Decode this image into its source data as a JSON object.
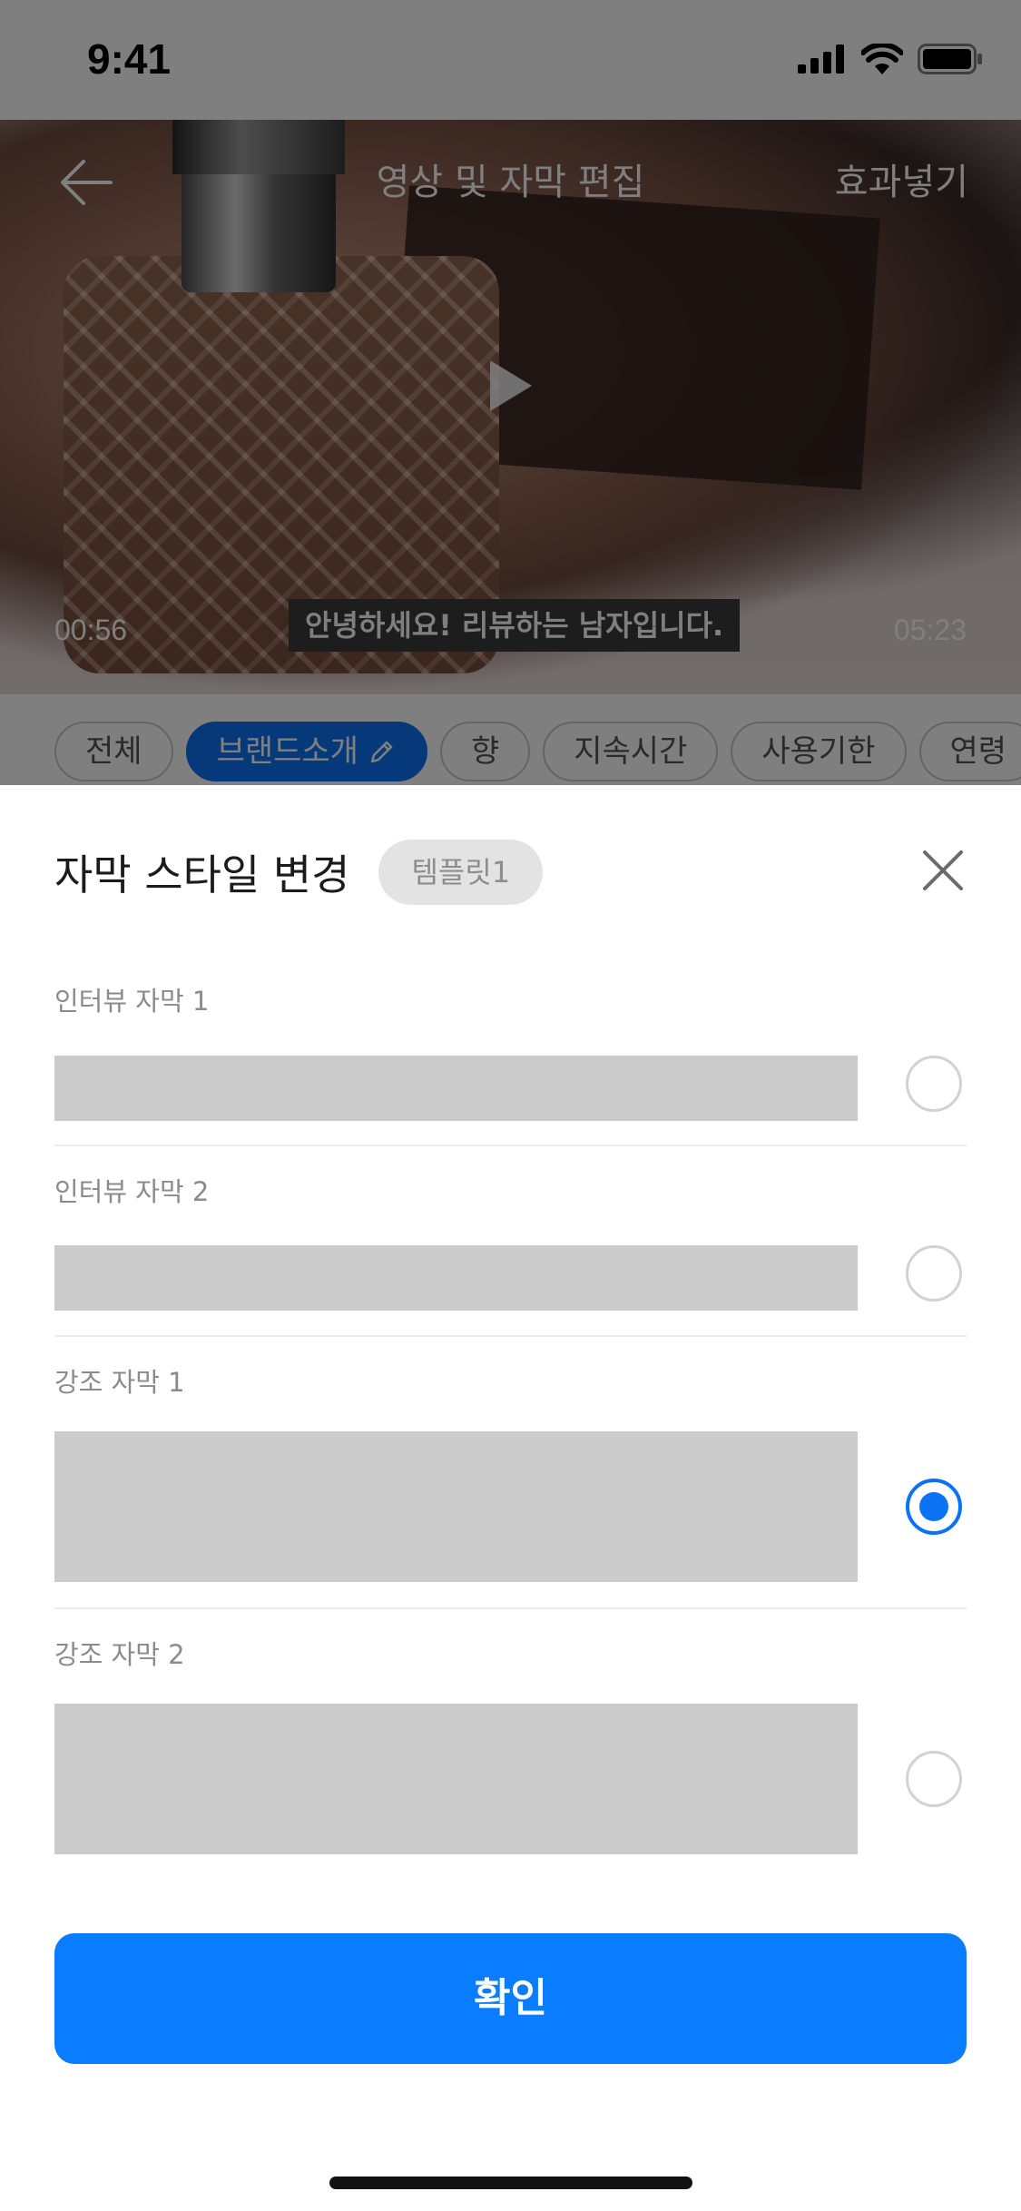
{
  "status_bar": {
    "time": "9:41"
  },
  "video_header": {
    "title": "영상 및 자막 편집",
    "effect_label": "효과넣기"
  },
  "video": {
    "current_time": "00:56",
    "total_time": "05:23",
    "subtitle": "안녕하세요! 리뷰하는 남자입니다."
  },
  "chips": [
    {
      "label": "전체",
      "active": false
    },
    {
      "label": "브랜드소개",
      "active": true
    },
    {
      "label": "향",
      "active": false
    },
    {
      "label": "지속시간",
      "active": false
    },
    {
      "label": "사용기한",
      "active": false
    },
    {
      "label": "연령",
      "active": false
    }
  ],
  "sheet": {
    "title": "자막 스타일 변경",
    "badge": "템플릿1",
    "options": [
      {
        "label": "인터뷰 자막 1",
        "selected": false
      },
      {
        "label": "인터뷰 자막 2",
        "selected": false
      },
      {
        "label": "강조 자막 1",
        "selected": true
      },
      {
        "label": "강조 자막 2",
        "selected": false
      }
    ],
    "confirm_label": "확인"
  },
  "colors": {
    "accent": "#0a7cff",
    "preview_gray": "#cbcbcb"
  }
}
